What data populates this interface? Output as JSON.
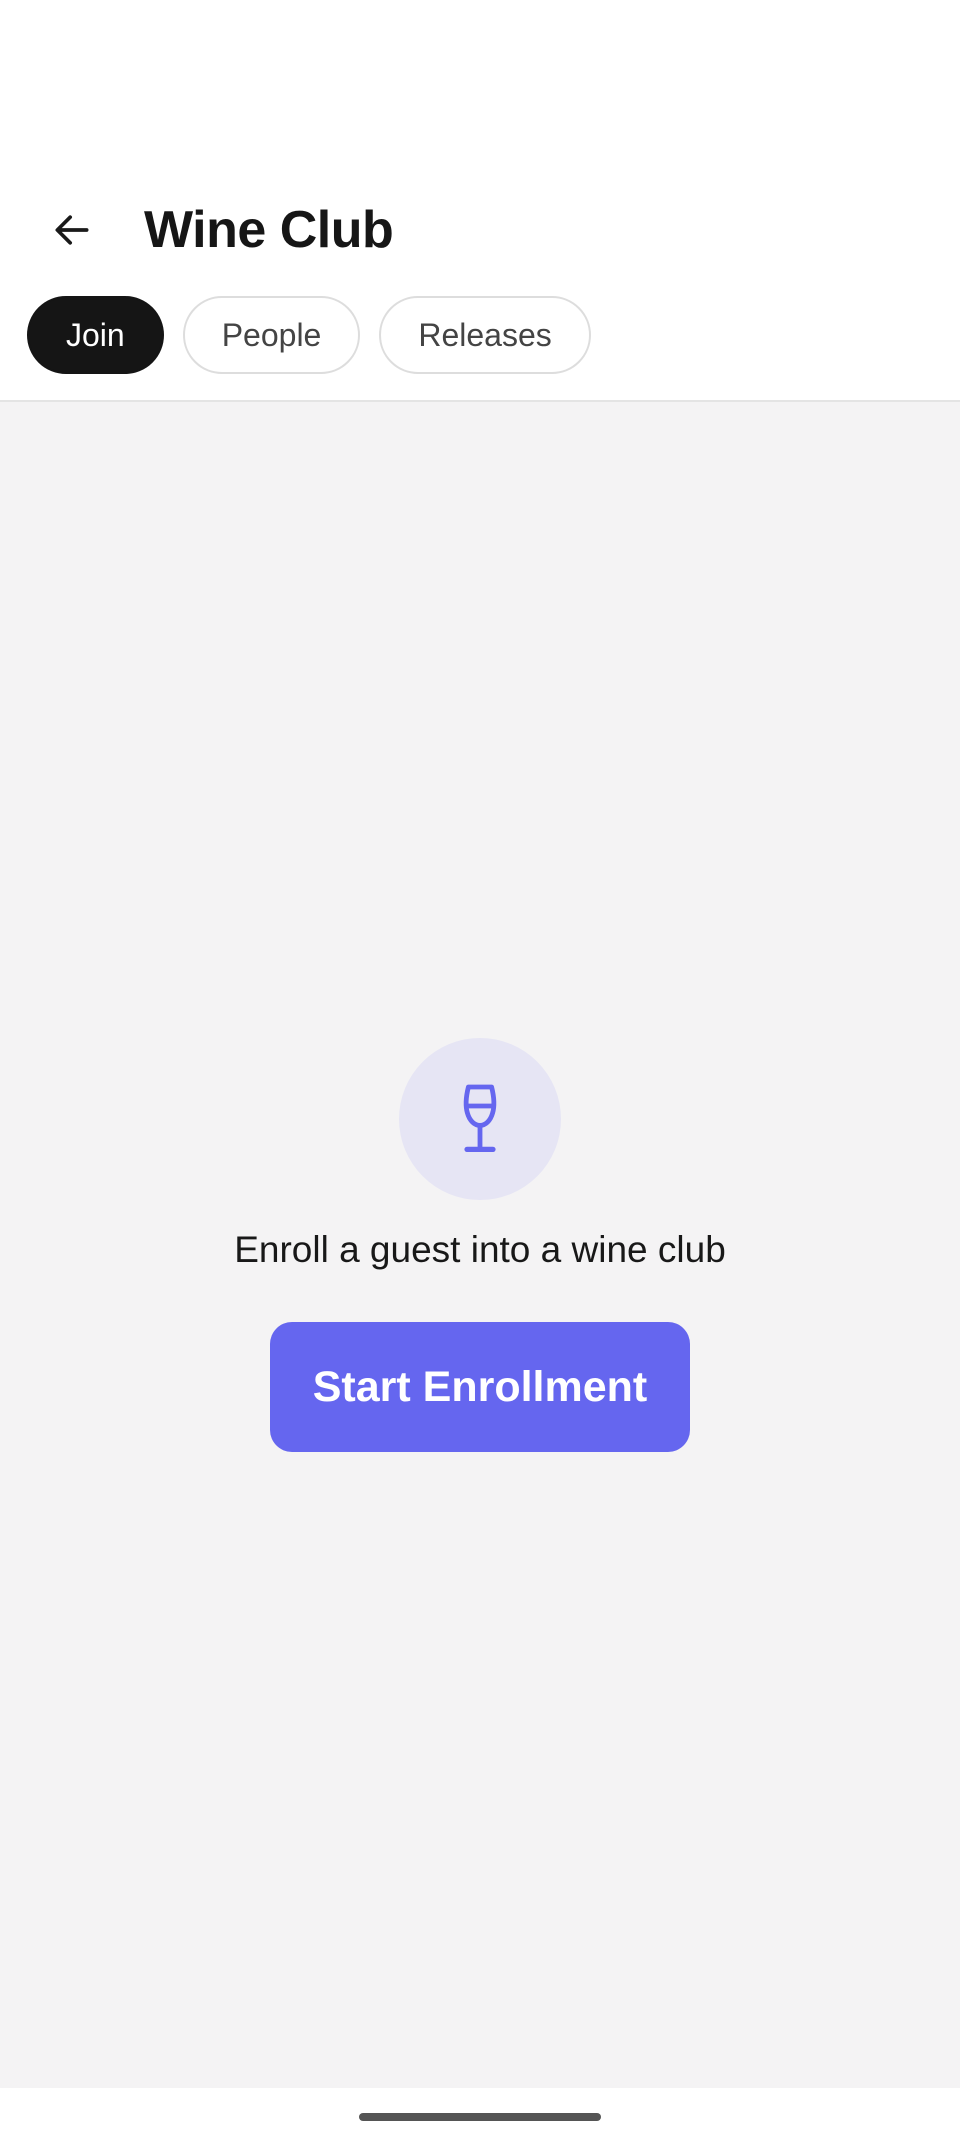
{
  "header": {
    "back_icon": "arrow-left-icon",
    "title": "Wine Club"
  },
  "tabs": [
    {
      "label": "Join",
      "active": true
    },
    {
      "label": "People",
      "active": false
    },
    {
      "label": "Releases",
      "active": false
    }
  ],
  "empty_state": {
    "icon": "wine-glass-icon",
    "message": "Enroll a guest into a wine club",
    "button_label": "Start Enrollment"
  },
  "colors": {
    "accent": "#6566EF",
    "accent_soft": "#E6E5F4",
    "active_tab": "#151515",
    "background": "#F4F3F4"
  }
}
